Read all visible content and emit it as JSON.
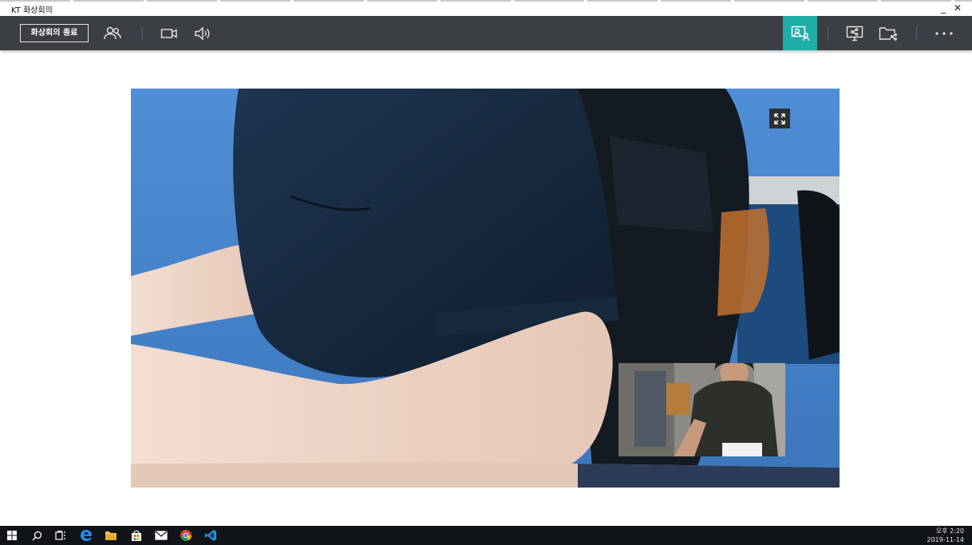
{
  "window": {
    "title": "KT 화상회의",
    "minimize_glyph": "_",
    "close_glyph": "✕"
  },
  "toolbar": {
    "end_meeting_label": "화상회의 종료",
    "icons": [
      "participants-icon",
      "camera-icon",
      "speaker-icon",
      "presenter-view-icon",
      "screen-share-icon",
      "file-share-icon",
      "more-icon"
    ],
    "accent_color": "#1fada8"
  },
  "video": {
    "expand_icon": "fullscreen-icon"
  },
  "taskbar": {
    "icons": [
      "windows-start-icon",
      "search-icon",
      "task-view-icon",
      "edge-icon",
      "file-explorer-icon",
      "store-icon",
      "mail-icon",
      "chrome-icon",
      "vscode-icon"
    ],
    "clock_time": "오후 2:20",
    "clock_date": "2019-11-14"
  }
}
